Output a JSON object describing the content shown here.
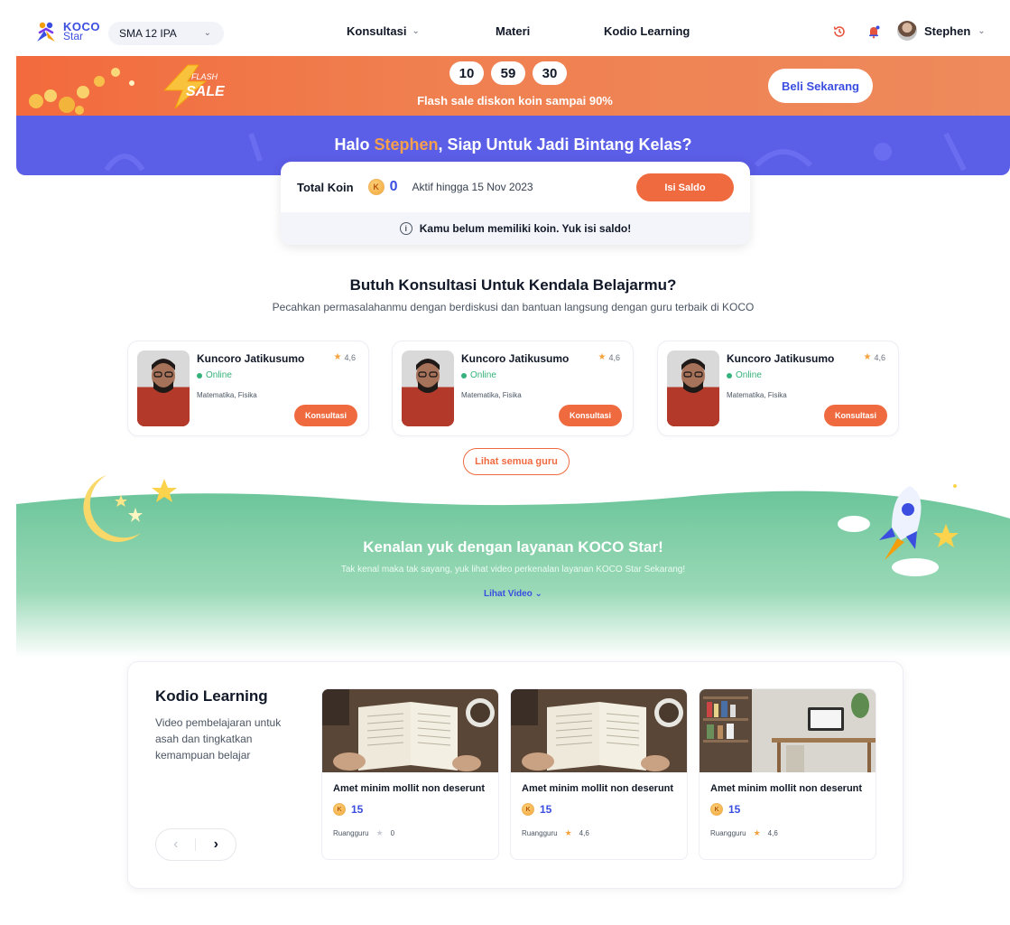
{
  "nav": {
    "logo_line1": "KOCO",
    "logo_line2": "Star",
    "grade": "SMA 12 IPA",
    "menu": [
      {
        "label": "Konsultasi",
        "has_dropdown": true
      },
      {
        "label": "Materi",
        "has_dropdown": false
      },
      {
        "label": "Kodio Learning",
        "has_dropdown": false
      }
    ],
    "icons": [
      "history-icon",
      "notification-bell-icon"
    ],
    "user_name": "Stephen"
  },
  "flash": {
    "badge_top": "FLASH",
    "badge_bottom": "SALE",
    "timer": [
      "10",
      "59",
      "30"
    ],
    "text": "Flash sale diskon koin sampai 90%",
    "cta": "Beli Sekarang"
  },
  "greeting": {
    "prefix": "Halo ",
    "name": "Stephen",
    "suffix": ", Siap Untuk Jadi Bintang Kelas?"
  },
  "coins": {
    "label": "Total Koin",
    "coin_symbol": "K",
    "value": "0",
    "active": "Aktif hingga 15 Nov 2023",
    "cta": "Isi Saldo",
    "notice": "Kamu belum memiliki koin. Yuk isi saldo!"
  },
  "consult": {
    "title": "Butuh Konsultasi Untuk Kendala Belajarmu?",
    "subtitle": "Pecahkan permasalahanmu dengan berdiskusi dan bantuan langsung dengan guru terbaik di KOCO",
    "teachers": [
      {
        "name": "Kuncoro Jatikusumo",
        "rating": "4,6",
        "status": "Online",
        "subjects": "Matematika, Fisika",
        "cta": "Konsultasi"
      },
      {
        "name": "Kuncoro Jatikusumo",
        "rating": "4,6",
        "status": "Online",
        "subjects": "Matematika, Fisika",
        "cta": "Konsultasi"
      },
      {
        "name": "Kuncoro Jatikusumo",
        "rating": "4,6",
        "status": "Online",
        "subjects": "Matematika, Fisika",
        "cta": "Konsultasi"
      }
    ],
    "see_all": "Lihat semua guru"
  },
  "intro": {
    "title": "Kenalan yuk dengan layanan KOCO Star!",
    "subtitle": "Tak kenal maka tak sayang, yuk lihat video perkenalan layanan KOCO Star Sekarang!",
    "link": "Lihat Video"
  },
  "kodio": {
    "title": "Kodio Learning",
    "description": "Video pembelajaran untuk asah dan tingkatkan kemampuan belajar",
    "videos": [
      {
        "title": "Amet minim mollit non deserunt",
        "price": "15",
        "provider": "Ruangguru",
        "rating": "0",
        "rated": false
      },
      {
        "title": "Amet minim mollit non deserunt",
        "price": "15",
        "provider": "Ruangguru",
        "rating": "4,6",
        "rated": true
      },
      {
        "title": "Amet minim mollit non deserunt",
        "price": "15",
        "provider": "Ruangguru",
        "rating": "4,6",
        "rated": true
      }
    ]
  },
  "colors": {
    "primary": "#3b4ee0",
    "accent_orange": "#ef6a3f",
    "greeting_bg": "#5b5ee6",
    "online_green": "#34b27b",
    "intro_green": "#6cc59a"
  }
}
